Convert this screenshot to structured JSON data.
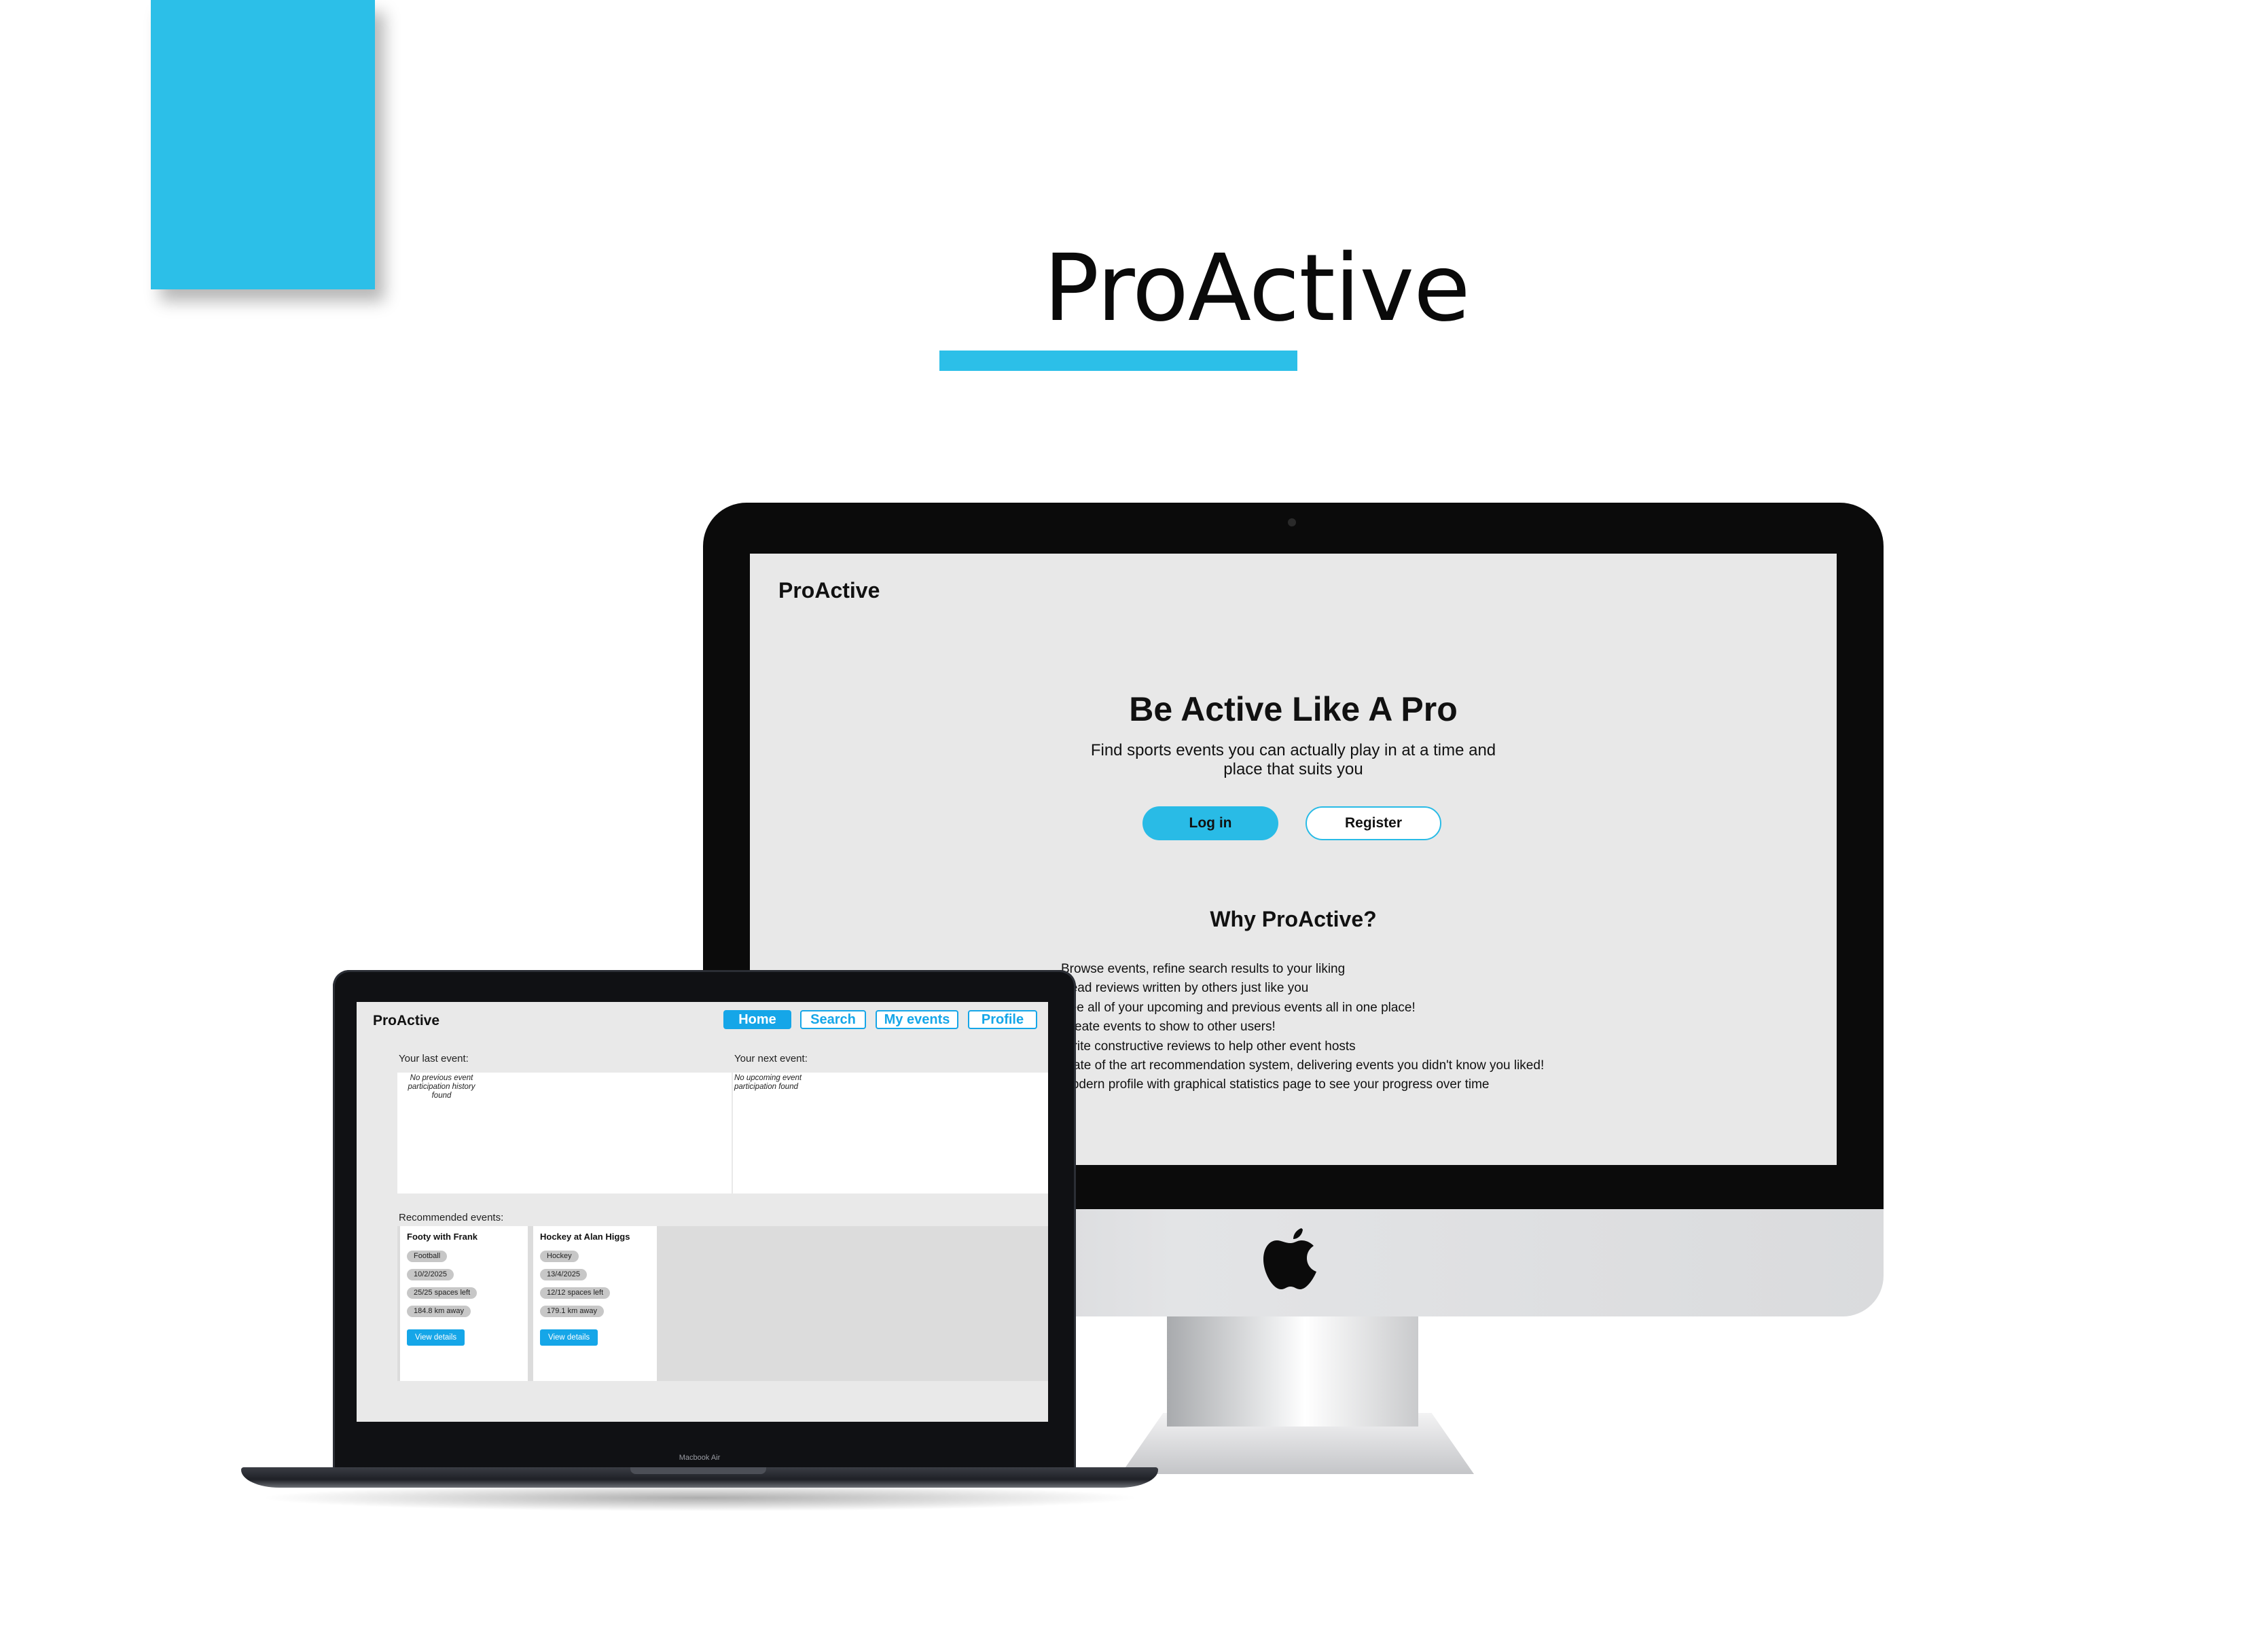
{
  "colors": {
    "accent": "#2cbfe8",
    "tab_blue": "#15a6e8",
    "screen_bg": "#e8e8e8"
  },
  "page": {
    "title": "ProActive"
  },
  "imac": {
    "brand": "ProActive",
    "hero_title": "Be Active Like A Pro",
    "hero_subtitle_line1": "Find sports events you can actually play in at a time and",
    "hero_subtitle_line2": "place that suits you",
    "login_label": "Log in",
    "register_label": "Register",
    "why_title": "Why ProActive?",
    "features": [
      "Browse events, refine search results to your liking",
      "Read reviews written by others just like you",
      "See all of your upcoming and previous events all in one place!",
      "Create events to show to other users!",
      "Write constructive reviews to help other event hosts",
      "State of the art recommendation system, delivering events you didn't know you liked!",
      "Modern profile with graphical statistics page to see your progress over time"
    ],
    "logo_icon": "apple-icon"
  },
  "macbook": {
    "model_label": "Macbook Air",
    "brand": "ProActive",
    "tabs": [
      {
        "label": "Home",
        "active": true
      },
      {
        "label": "Search",
        "active": false
      },
      {
        "label": "My events",
        "active": false
      },
      {
        "label": "Profile",
        "active": false
      }
    ],
    "last_event_label": "Your last event:",
    "last_event_empty": "No previous event participation history found",
    "next_event_label": "Your next event:",
    "next_event_empty": "No upcoming event participation found",
    "recommended_label": "Recommended events:",
    "events": [
      {
        "title": "Footy with Frank",
        "sport": "Football",
        "date": "10/2/2025",
        "spaces": "25/25 spaces left",
        "distance": "184.8 km away",
        "action": "View details"
      },
      {
        "title": "Hockey at Alan Higgs",
        "sport": "Hockey",
        "date": "13/4/2025",
        "spaces": "12/12 spaces left",
        "distance": "179.1 km away",
        "action": "View details"
      }
    ]
  }
}
